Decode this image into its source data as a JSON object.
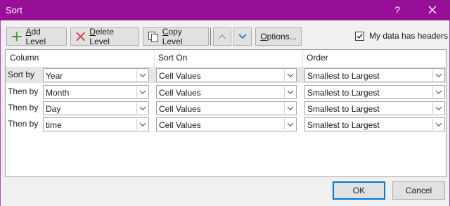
{
  "window": {
    "title": "Sort",
    "help_label": "?"
  },
  "toolbar": {
    "add_level": "Add Level",
    "delete_level": "Delete Level",
    "copy_level": "Copy Level",
    "options": "Options...",
    "headers_checkbox_label": "My data has headers",
    "headers_checked": true
  },
  "columns": {
    "column": "Column",
    "sort_on": "Sort On",
    "order": "Order"
  },
  "rows": [
    {
      "label": "Sort by",
      "column": "Year",
      "sort_on": "Cell Values",
      "order": "Smallest to Largest"
    },
    {
      "label": "Then by",
      "column": "Month",
      "sort_on": "Cell Values",
      "order": "Smallest to Largest"
    },
    {
      "label": "Then by",
      "column": "Day",
      "sort_on": "Cell Values",
      "order": "Smallest to Largest"
    },
    {
      "label": "Then by",
      "column": "time",
      "sort_on": "Cell Values",
      "order": "Smallest to Largest"
    }
  ],
  "footer": {
    "ok": "OK",
    "cancel": "Cancel"
  },
  "colors": {
    "titlebar": "#960f96",
    "accent_blue": "#0078d7",
    "add_green": "#3ea12c",
    "delete_red": "#d13438"
  },
  "icons": {
    "add": "plus-icon",
    "delete": "x-icon",
    "copy": "copy-icon",
    "up": "up-arrow-icon",
    "down": "down-arrow-icon",
    "close": "close-icon"
  }
}
